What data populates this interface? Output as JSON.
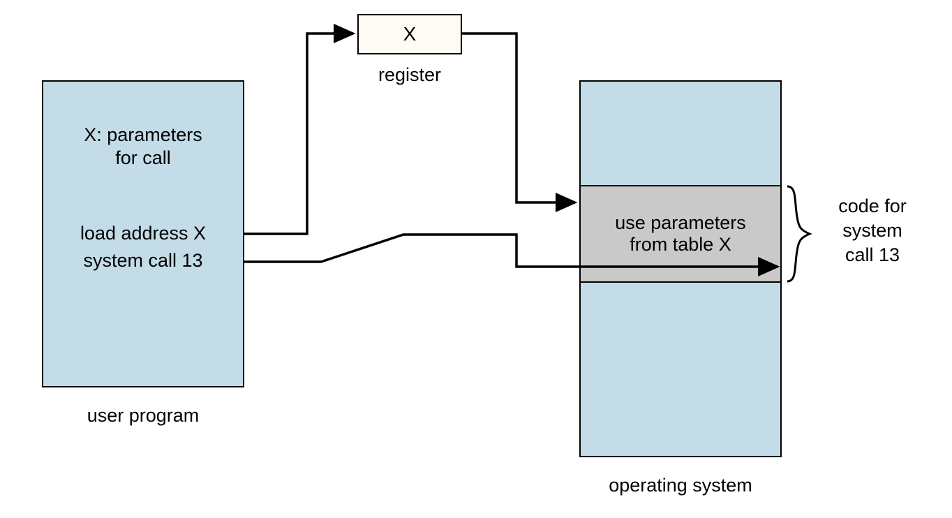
{
  "diagram": {
    "user_program": {
      "label": "user program",
      "text_line1": "X: parameters",
      "text_line2": "for call",
      "text_line3": "load address X",
      "text_line4": "system call 13"
    },
    "register": {
      "label": "register",
      "value": "X"
    },
    "os": {
      "label": "operating system",
      "segment_line1": "use parameters",
      "segment_line2": "from table X"
    },
    "annotation": {
      "line1": "code for",
      "line2": "system",
      "line3": "call 13"
    }
  }
}
